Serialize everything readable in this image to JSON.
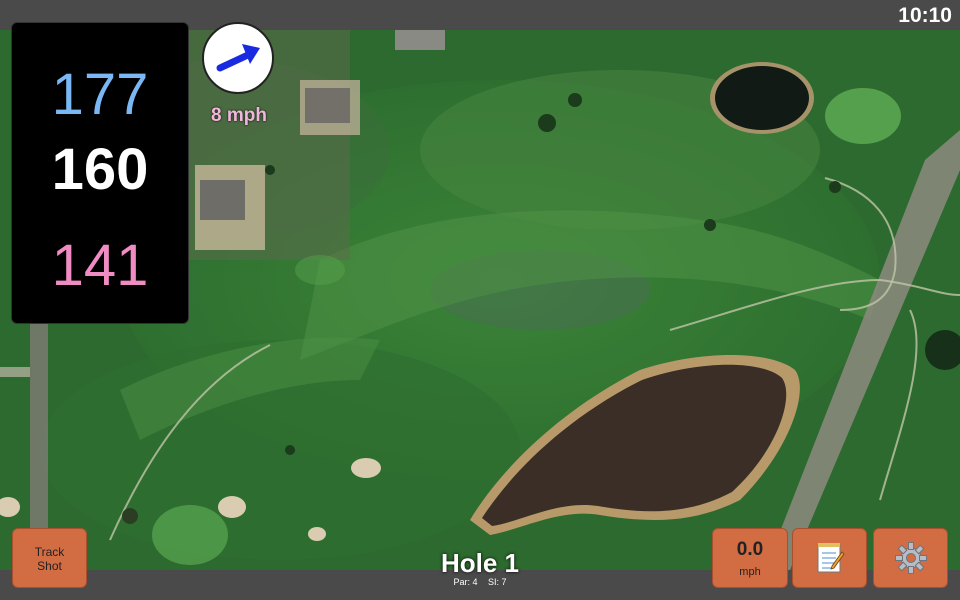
{
  "status": {
    "time": "10:10"
  },
  "distances": {
    "back": "177",
    "middle": "160",
    "front": "141"
  },
  "wind": {
    "speed_label": "8 mph",
    "icon": "wind-arrow-icon"
  },
  "hole": {
    "title": "Hole 1",
    "par_label": "Par: 4",
    "si_label": "SI: 7"
  },
  "buttons": {
    "track_shot_line1": "Track",
    "track_shot_line2": "Shot",
    "speed_value": "0.0",
    "speed_unit": "mph",
    "notes_icon": "notepad-icon",
    "settings_icon": "gear-icon"
  },
  "colors": {
    "back_distance": "#7ab8f5",
    "middle_distance": "#ffffff",
    "front_distance": "#f08cc4",
    "button_bg": "#d26c43",
    "wind_arrow": "#1a2ae0"
  }
}
